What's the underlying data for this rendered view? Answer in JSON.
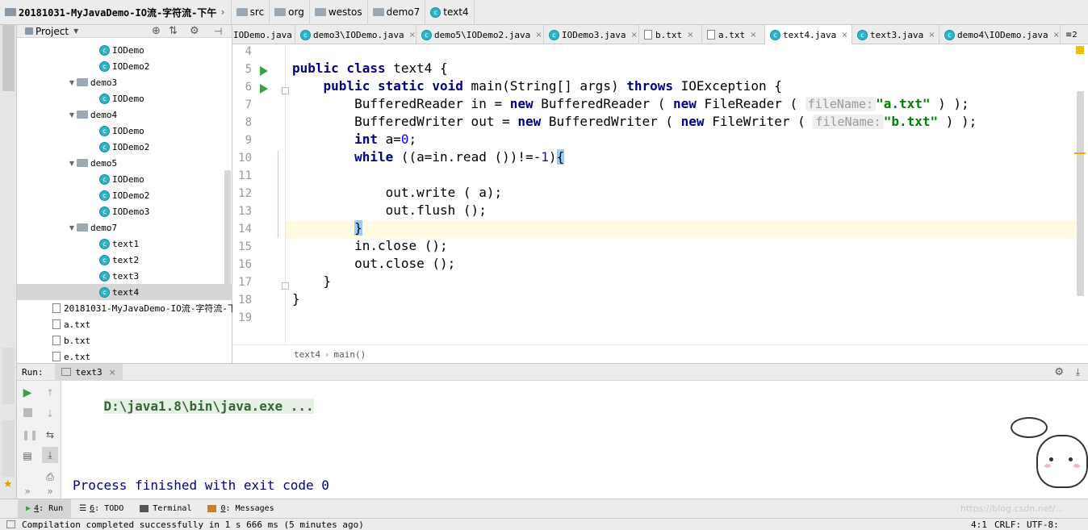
{
  "breadcrumb": [
    "20181031-MyJavaDemo-IO流-字符流-下午",
    "src",
    "org",
    "westos",
    "demo7",
    "text4"
  ],
  "project": {
    "title": "Project",
    "tree": [
      {
        "label": "IODemo",
        "type": "class",
        "indent": 3,
        "selected": false
      },
      {
        "label": "IODemo2",
        "type": "class",
        "indent": 3,
        "selected": false
      },
      {
        "label": "demo3",
        "type": "folder",
        "indent": 2,
        "selected": false
      },
      {
        "label": "IODemo",
        "type": "class",
        "indent": 3,
        "selected": false
      },
      {
        "label": "demo4",
        "type": "folder",
        "indent": 2,
        "selected": false
      },
      {
        "label": "IODemo",
        "type": "class",
        "indent": 3,
        "selected": false
      },
      {
        "label": "IODemo2",
        "type": "class",
        "indent": 3,
        "selected": false
      },
      {
        "label": "demo5",
        "type": "folder",
        "indent": 2,
        "selected": false
      },
      {
        "label": "IODemo",
        "type": "class",
        "indent": 3,
        "selected": false
      },
      {
        "label": "IODemo2",
        "type": "class",
        "indent": 3,
        "selected": false
      },
      {
        "label": "IODemo3",
        "type": "class",
        "indent": 3,
        "selected": false
      },
      {
        "label": "demo7",
        "type": "folder",
        "indent": 2,
        "selected": false
      },
      {
        "label": "text1",
        "type": "class",
        "indent": 3,
        "selected": false
      },
      {
        "label": "text2",
        "type": "class",
        "indent": 3,
        "selected": false
      },
      {
        "label": "text3",
        "type": "class",
        "indent": 3,
        "selected": false
      },
      {
        "label": "text4",
        "type": "class",
        "indent": 3,
        "selected": true
      },
      {
        "label": "20181031-MyJavaDemo-IO流-字符流-下午",
        "type": "file",
        "indent": 1,
        "selected": false
      },
      {
        "label": "a.txt",
        "type": "file",
        "indent": 1,
        "selected": false
      },
      {
        "label": "b.txt",
        "type": "file",
        "indent": 1,
        "selected": false
      },
      {
        "label": "e.txt",
        "type": "file",
        "indent": 1,
        "selected": false
      }
    ]
  },
  "tabs": [
    {
      "label": "IODemo.java",
      "active": false
    },
    {
      "label": "demo3\\IODemo.java",
      "active": false
    },
    {
      "label": "demo5\\IODemo2.java",
      "active": false
    },
    {
      "label": "IODemo3.java",
      "active": false
    },
    {
      "label": "b.txt",
      "active": false
    },
    {
      "label": "a.txt",
      "active": false
    },
    {
      "label": "text4.java",
      "active": true
    },
    {
      "label": "text3.java",
      "active": false
    },
    {
      "label": "demo4\\IODemo.java",
      "active": false
    }
  ],
  "tabs_overflow": "≡2",
  "editor": {
    "line_numbers": [
      "4",
      "5",
      "6",
      "7",
      "8",
      "9",
      "10",
      "11",
      "12",
      "13",
      "14",
      "15",
      "16",
      "17",
      "18",
      "19"
    ],
    "hints": {
      "filename1": "fileName:",
      "filename2": "fileName:"
    },
    "strings": {
      "a": "\"a.txt\"",
      "b": "\"b.txt\""
    },
    "breadcrumbs": [
      "text4",
      "main()"
    ]
  },
  "run": {
    "label": "Run:",
    "tab": "text3",
    "console": [
      "D:\\java1.8\\bin\\java.exe ...",
      "",
      "Process finished with exit code 0"
    ]
  },
  "bottom_tools": [
    {
      "key": "4",
      "label": ": Run"
    },
    {
      "key": "6",
      "label": ": TODO"
    },
    {
      "key": "",
      "label": "Terminal"
    },
    {
      "key": "0",
      "label": ": Messages"
    }
  ],
  "status": {
    "message": "Compilation completed successfully in 1 s 666 ms (5 minutes ago)",
    "position": "4:1",
    "line_sep": "CRLF:",
    "encoding": "UTF-8:"
  },
  "watermark": "https://blog.csdn.net/..."
}
